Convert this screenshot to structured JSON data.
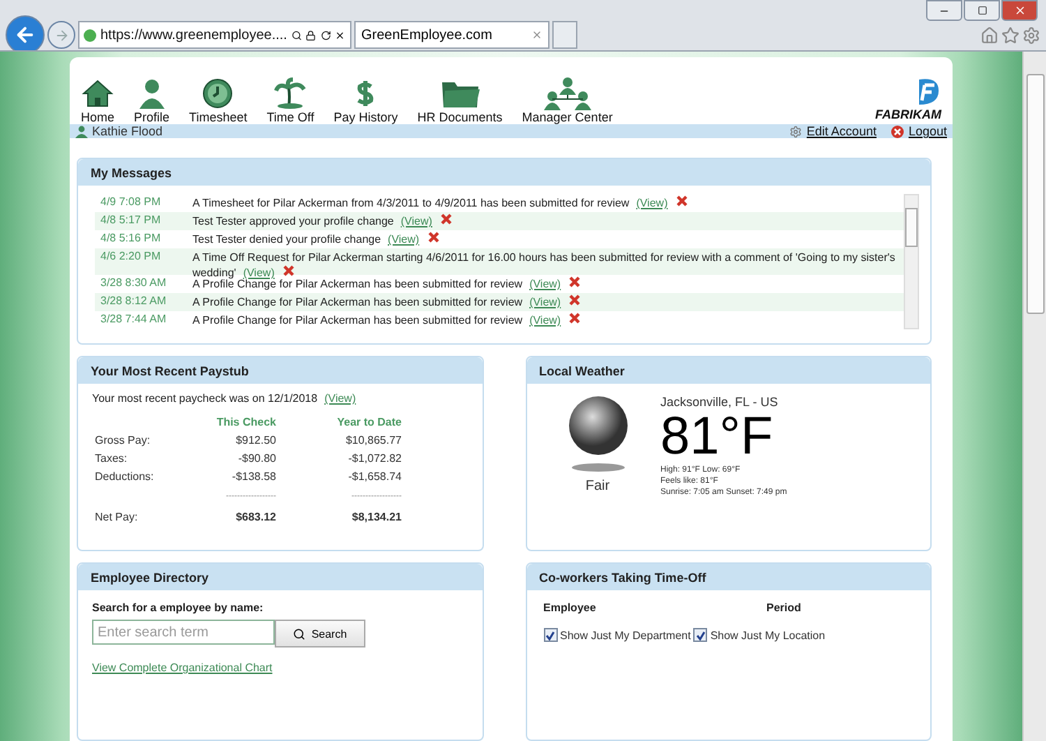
{
  "browser": {
    "url": "https://www.greenemployee....",
    "tab_title": "GreenEmployee.com"
  },
  "nav": [
    {
      "label": "Home"
    },
    {
      "label": "Profile"
    },
    {
      "label": "Timesheet"
    },
    {
      "label": "Time Off"
    },
    {
      "label": "Pay History"
    },
    {
      "label": "HR Documents"
    },
    {
      "label": "Manager Center"
    }
  ],
  "brand": "FABRIKAM",
  "user": {
    "name": "Kathie Flood",
    "links": [
      "Edit Account",
      "Logout"
    ]
  },
  "messages": {
    "title": "My Messages",
    "rows": [
      {
        "time": "4/9 7:08 PM",
        "text": "A Timesheet for Pilar Ackerman from 4/3/2011 to 4/9/2011 has been submitted for review",
        "link": "(View)"
      },
      {
        "time": "4/8 5:17 PM",
        "text": "Test Tester approved your profile change",
        "link": "(View)"
      },
      {
        "time": "4/8 5:16 PM",
        "text": "Test Tester denied your profile change",
        "link": "(View)"
      },
      {
        "time": "4/6 2:20 PM",
        "text": "A Time Off Request for Pilar Ackerman starting 4/6/2011 for 16.00 hours has been submitted for review with a comment of 'Going to my sister's wedding'",
        "link": "(View)"
      },
      {
        "time": "3/28 8:30 AM",
        "text": "A Profile Change for Pilar Ackerman has been submitted for review",
        "link": "(View)"
      },
      {
        "time": "3/28 8:12 AM",
        "text": "A Profile Change for Pilar Ackerman has been submitted for review",
        "link": "(View)"
      },
      {
        "time": "3/28 7:44 AM",
        "text": "A Profile Change for Pilar Ackerman has been submitted for review",
        "link": "(View)"
      }
    ]
  },
  "paystub": {
    "title": "Your Most Recent Paystub",
    "intro": "Your most recent paycheck was on 12/1/2018",
    "link": "(View)",
    "columns": [
      "This Check",
      "Year to Date"
    ],
    "rows": [
      {
        "kind": "line",
        "label": "Gross Pay:",
        "this_check": "$912.50",
        "ytd": "$10,865.77"
      },
      {
        "kind": "line",
        "label": "Taxes:",
        "this_check": "-$90.80",
        "ytd": "-$1,072.82"
      },
      {
        "kind": "line",
        "label": "Deductions:",
        "this_check": "-$138.58",
        "ytd": "-$1,658.74"
      },
      {
        "kind": "rule",
        "this_check": "------------------",
        "ytd": "------------------"
      },
      {
        "kind": "total",
        "label": "Net Pay:",
        "this_check": "$683.12",
        "ytd": "$8,134.21"
      }
    ]
  },
  "weather": {
    "title": "Local Weather",
    "condition": "Fair",
    "location": "Jacksonville, FL - US",
    "temperature": "81°F",
    "details": [
      "High: 91°F Low: 69°F",
      "Feels like: 81°F",
      "Sunrise: 7:05 am Sunset: 7:49 pm"
    ]
  },
  "directory": {
    "title": "Employee Directory",
    "prompt": "Search for a employee by name:",
    "placeholder": "Enter search term",
    "button": "Search",
    "link": "View Complete Organizational Chart"
  },
  "timeoff": {
    "title": "Co-workers Taking Time-Off",
    "columns": [
      "Employee",
      "Period"
    ],
    "filters": [
      {
        "label": "Show Just My Department",
        "checked": true
      },
      {
        "label": "Show Just My Location",
        "checked": true
      }
    ]
  }
}
